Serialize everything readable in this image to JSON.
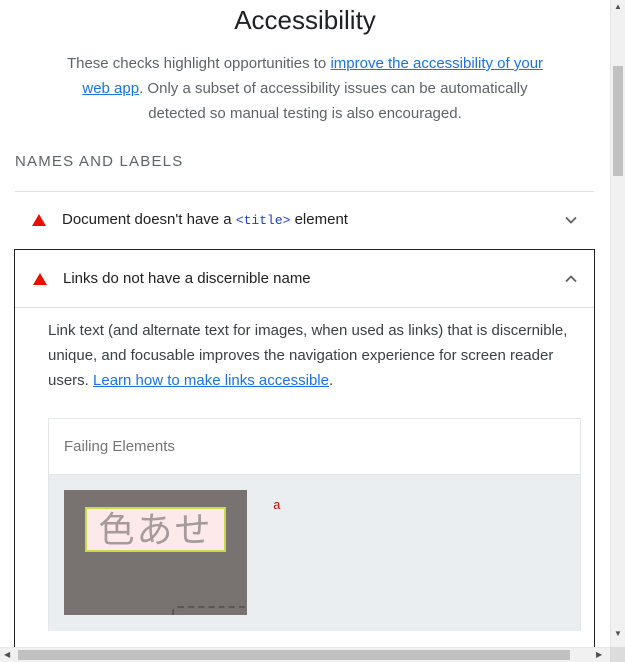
{
  "page": {
    "title": "Accessibility",
    "description_before_link": "These checks highlight opportunities to ",
    "description_link": "improve the accessibility of your web app",
    "description_after_link": ". Only a subset of accessibility issues can be automatically detected so manual testing is also encouraged."
  },
  "group": {
    "title": "NAMES AND LABELS"
  },
  "audits": [
    {
      "title_before": "Document doesn't have a ",
      "title_code": "<title>",
      "title_after": " element",
      "status": "fail",
      "expanded": false
    },
    {
      "title": "Links do not have a discernible name",
      "status": "fail",
      "expanded": true,
      "description_before_link": "Link text (and alternate text for images, when used as links) that is discernible, unique, and focusable improves the navigation experience for screen reader users. ",
      "description_link": "Learn how to make links accessible",
      "description_after_link": ".",
      "failing_elements": {
        "header": "Failing Elements",
        "items": [
          {
            "thumbnail_text": "色あせ",
            "node_label": "a"
          }
        ]
      }
    }
  ],
  "colors": {
    "fail": "#eb0f00",
    "link": "#1a73e8",
    "code": "#1a3ed4",
    "node": "#c80000"
  },
  "icons": {
    "fail": "triangle-fail-icon",
    "collapsed": "chevron-down-icon",
    "expanded": "chevron-up-icon"
  }
}
